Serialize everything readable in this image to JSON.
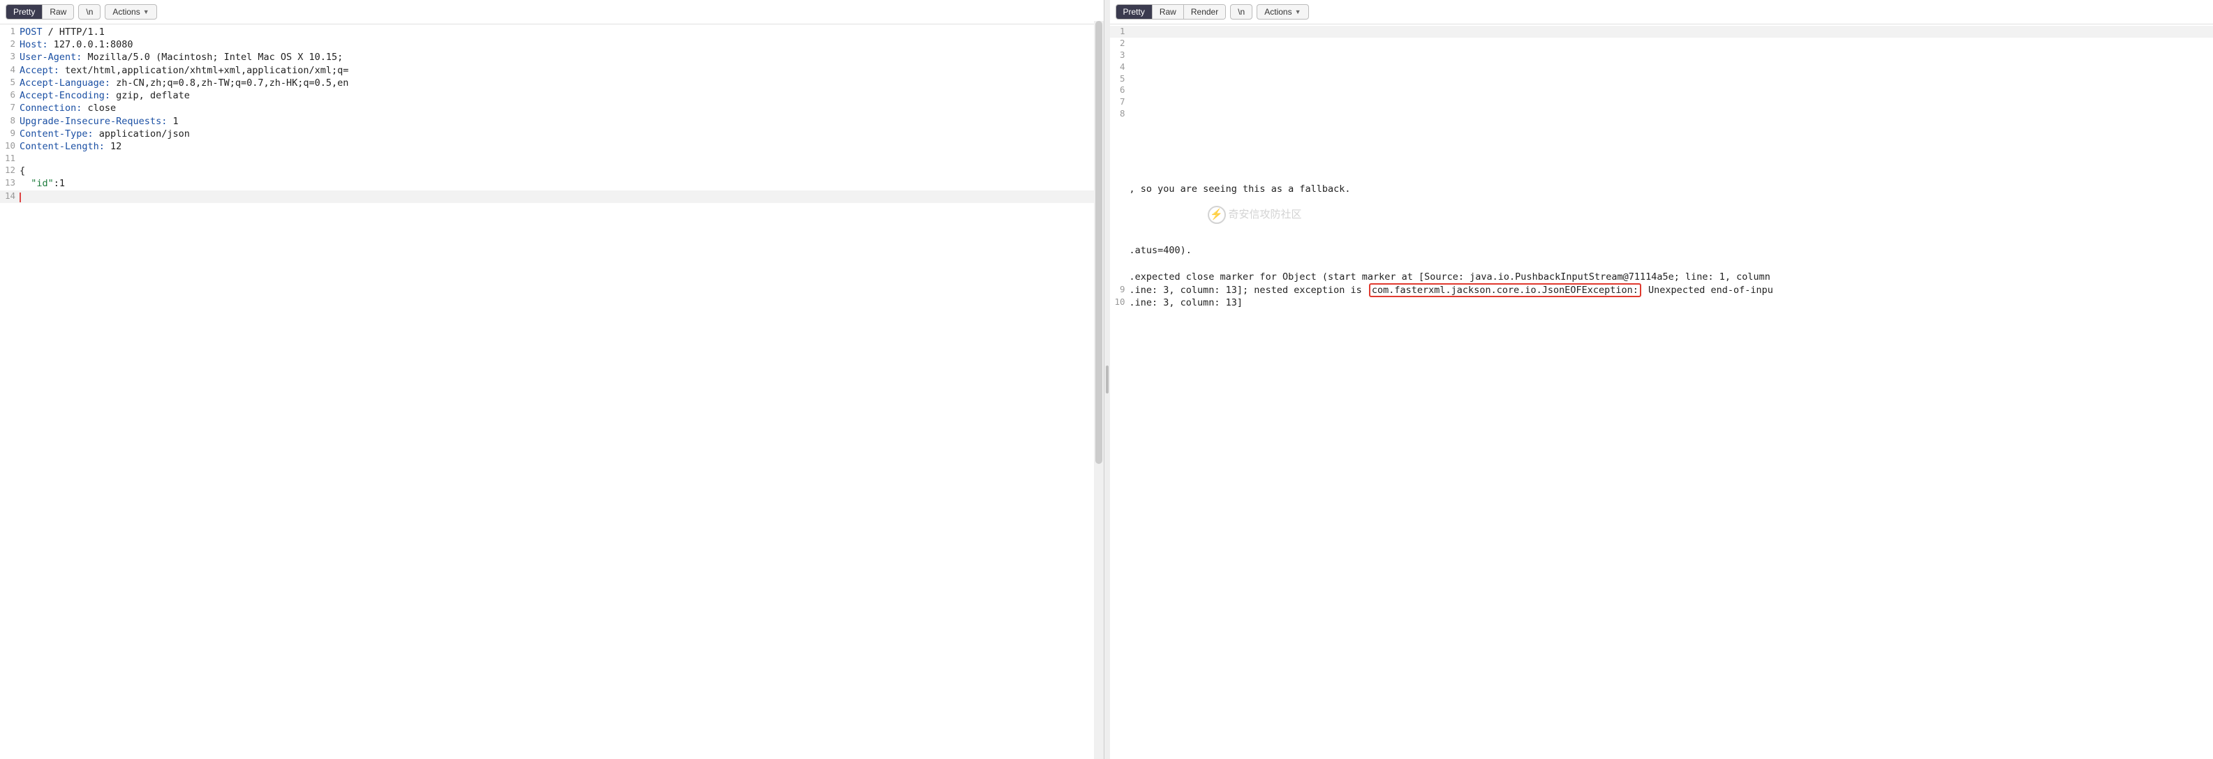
{
  "request": {
    "tabs": {
      "pretty": "Pretty",
      "raw": "Raw"
    },
    "newline_btn": "\\n",
    "actions_btn": "Actions",
    "lines": [
      {
        "n": 1,
        "header": "POST",
        "rest": " / HTTP/1.1"
      },
      {
        "n": 2,
        "header": "Host:",
        "rest": " 127.0.0.1:8080"
      },
      {
        "n": 3,
        "header": "User-Agent:",
        "rest": " Mozilla/5.0 (Macintosh; Intel Mac OS X 10.15;"
      },
      {
        "n": 4,
        "header": "Accept:",
        "rest": " text/html,application/xhtml+xml,application/xml;q="
      },
      {
        "n": 5,
        "header": "Accept-Language:",
        "rest": " zh-CN,zh;q=0.8,zh-TW;q=0.7,zh-HK;q=0.5,en"
      },
      {
        "n": 6,
        "header": "Accept-Encoding:",
        "rest": " gzip, deflate"
      },
      {
        "n": 7,
        "header": "Connection:",
        "rest": " close"
      },
      {
        "n": 8,
        "header": "Upgrade-Insecure-Requests:",
        "rest": " 1"
      },
      {
        "n": 9,
        "header": "Content-Type:",
        "rest": " application/json"
      },
      {
        "n": 10,
        "header": "Content-Length:",
        "rest": " 12"
      },
      {
        "n": 11,
        "header": "",
        "rest": ""
      },
      {
        "n": 12,
        "header": "",
        "rest": "{"
      },
      {
        "n": 13,
        "header": "",
        "rest": "  \"id\":1",
        "is_json_key": true
      },
      {
        "n": 14,
        "header": "",
        "rest": "",
        "current": true
      }
    ]
  },
  "response": {
    "tabs": {
      "pretty": "Pretty",
      "raw": "Raw",
      "render": "Render"
    },
    "newline_btn": "\\n",
    "actions_btn": "Actions",
    "top_numbers": [
      "1",
      "2",
      "3",
      "4",
      "5",
      "6",
      "7",
      "8"
    ],
    "fragment_fallback": ", so you are seeing this as a fallback.",
    "fragment_status": ".atus=400).",
    "line8": {
      "num": "",
      "text": ".expected close marker for Object (start marker at [Source: java.io.PushbackInputStream@71114a5e; line: 1, column"
    },
    "line9": {
      "num": "9",
      "pre": ".ine: 3, column: 13]; nested exception is",
      "highlight": "com.fasterxml.jackson.core.io.JsonEOFException:",
      "post": "Unexpected end-of-inpu"
    },
    "line10": {
      "num": "10",
      "text": ".ine: 3, column: 13]"
    }
  },
  "watermark": "奇安信攻防社区"
}
